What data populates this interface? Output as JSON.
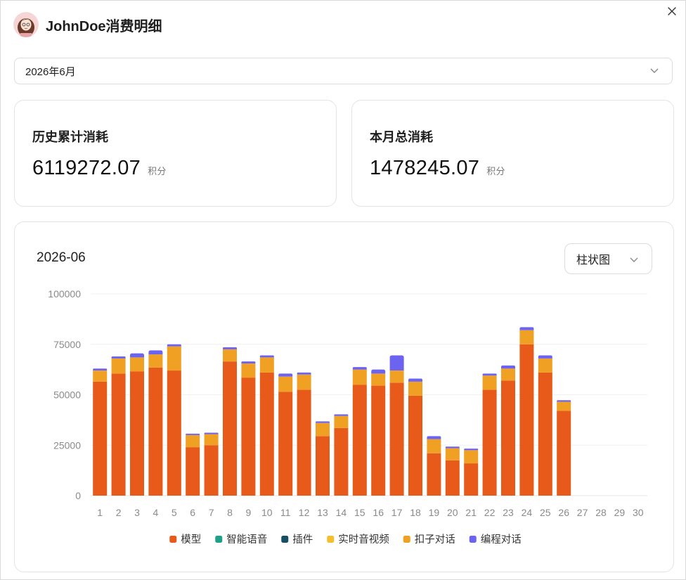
{
  "header": {
    "title": "JohnDoe消费明细"
  },
  "month_select": {
    "value": "2026年6月"
  },
  "cards": [
    {
      "label": "历史累计消耗",
      "value": "6119272.07",
      "unit": "积分"
    },
    {
      "label": "本月总消耗",
      "value": "1478245.07",
      "unit": "积分"
    }
  ],
  "chart_panel": {
    "title": "2026-06",
    "type_select": "柱状图"
  },
  "colors": {
    "model": "#E85A19",
    "voice": "#20A08A",
    "plugin": "#164E63",
    "rtc": "#F5BE2E",
    "kouzi": "#F0A023",
    "coding": "#6C63F0"
  },
  "chart_data": {
    "type": "bar",
    "stacked": true,
    "categories": [
      "1",
      "2",
      "3",
      "4",
      "5",
      "6",
      "7",
      "8",
      "9",
      "10",
      "11",
      "12",
      "13",
      "14",
      "15",
      "16",
      "17",
      "18",
      "19",
      "20",
      "21",
      "22",
      "23",
      "24",
      "25",
      "26",
      "27",
      "28",
      "29",
      "30"
    ],
    "ylim": [
      0,
      100000
    ],
    "yticks": [
      0,
      25000,
      50000,
      75000,
      100000
    ],
    "grid": true,
    "legend_position": "bottom",
    "series": [
      {
        "name": "模型",
        "color_key": "model",
        "values": [
          56500,
          60500,
          61500,
          63500,
          62000,
          24000,
          25000,
          66500,
          58500,
          61000,
          51500,
          52500,
          29500,
          33500,
          55000,
          54500,
          56000,
          49500,
          21000,
          17500,
          16000,
          52500,
          57000,
          75000,
          61000,
          42000,
          0,
          0,
          0,
          0
        ]
      },
      {
        "name": "智能语音",
        "color_key": "voice",
        "values": [
          0,
          0,
          0,
          0,
          0,
          0,
          0,
          0,
          0,
          0,
          0,
          0,
          0,
          0,
          0,
          0,
          0,
          0,
          0,
          0,
          0,
          0,
          0,
          0,
          0,
          0,
          0,
          0,
          0,
          0
        ]
      },
      {
        "name": "插件",
        "color_key": "plugin",
        "values": [
          0,
          0,
          0,
          0,
          0,
          0,
          0,
          0,
          0,
          0,
          0,
          0,
          0,
          0,
          0,
          0,
          0,
          0,
          0,
          0,
          0,
          0,
          0,
          0,
          0,
          0,
          0,
          0,
          0,
          0
        ]
      },
      {
        "name": "实时音视频",
        "color_key": "rtc",
        "values": [
          0,
          0,
          0,
          0,
          0,
          0,
          0,
          0,
          0,
          0,
          0,
          0,
          0,
          0,
          0,
          0,
          0,
          0,
          0,
          0,
          0,
          0,
          0,
          0,
          0,
          0,
          0,
          0,
          0,
          0
        ]
      },
      {
        "name": "扣子对话",
        "color_key": "kouzi",
        "values": [
          5500,
          7500,
          7000,
          6500,
          12000,
          6000,
          5500,
          6000,
          7000,
          7500,
          7500,
          7500,
          6500,
          6000,
          7500,
          6000,
          6000,
          7000,
          7000,
          6000,
          6500,
          7000,
          6000,
          7000,
          7000,
          4500,
          0,
          0,
          0,
          0
        ]
      },
      {
        "name": "编程对话",
        "color_key": "coding",
        "values": [
          1000,
          1000,
          2000,
          2000,
          1000,
          700,
          700,
          1000,
          1000,
          1000,
          1500,
          1000,
          800,
          800,
          1200,
          2000,
          7500,
          1500,
          1500,
          800,
          800,
          1000,
          1500,
          1500,
          1500,
          800,
          0,
          0,
          0,
          0
        ]
      }
    ]
  }
}
